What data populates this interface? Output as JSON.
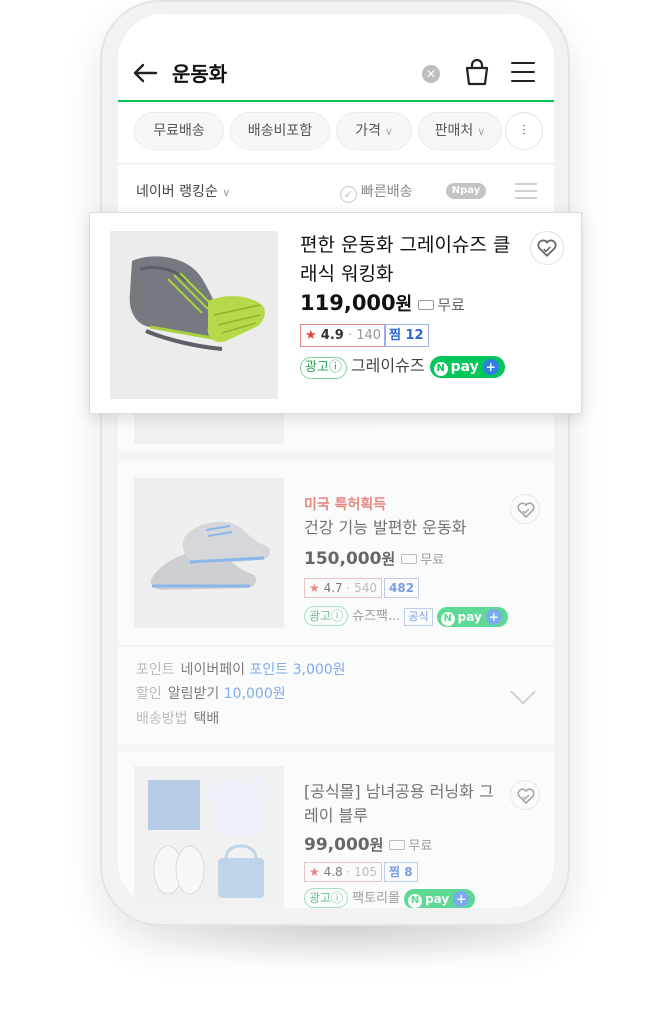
{
  "header": {
    "query": "운동화"
  },
  "filters": {
    "chips": [
      "무료배송",
      "배송비포함",
      "가격",
      "판매처"
    ]
  },
  "sortbar": {
    "sort_label": "네이버 랭킹순",
    "fast_label": "빠른배송",
    "npay_label": "pay"
  },
  "popup": {
    "title": "편한 운동화 그레이슈즈 클래식 워킹화",
    "price": "119,000",
    "currency": "원",
    "shipping": "무료",
    "rating": "4.9",
    "reviews": "140",
    "zzim_label": "찜",
    "zzim_count": "12",
    "ad_label": "광고",
    "seller": "그레이슈즈",
    "npay": "pay"
  },
  "product2": {
    "badge": "미국 특허획득",
    "title": "건강 기능 발편한 운동화",
    "price": "150,000",
    "currency": "원",
    "shipping": "무료",
    "rating": "4.7",
    "reviews": "540",
    "zzim_count": "482",
    "ad_label": "광고",
    "seller": "슈즈팩...",
    "official": "공식",
    "npay": "pay"
  },
  "points": {
    "row1_label": "포인트",
    "row1_mid": "네이버페이",
    "row1_value": "포인트 3,000원",
    "row2_label": "할인",
    "row2_mid": "알림받기",
    "row2_value": "10,000원",
    "row3_label": "배송방법",
    "row3_value": "택배"
  },
  "product3": {
    "title": "[공식몰] 남녀공용 러닝화 그레이 블루",
    "price": "99,000",
    "currency": "원",
    "shipping": "무료",
    "rating": "4.8",
    "reviews": "105",
    "zzim_label": "찜",
    "zzim_count": "8",
    "ad_label": "광고",
    "seller": "팩토리몰",
    "npay": "pay"
  },
  "colors": {
    "brand": "#03c75a",
    "star": "#e0453a",
    "link": "#3c7ee6"
  }
}
